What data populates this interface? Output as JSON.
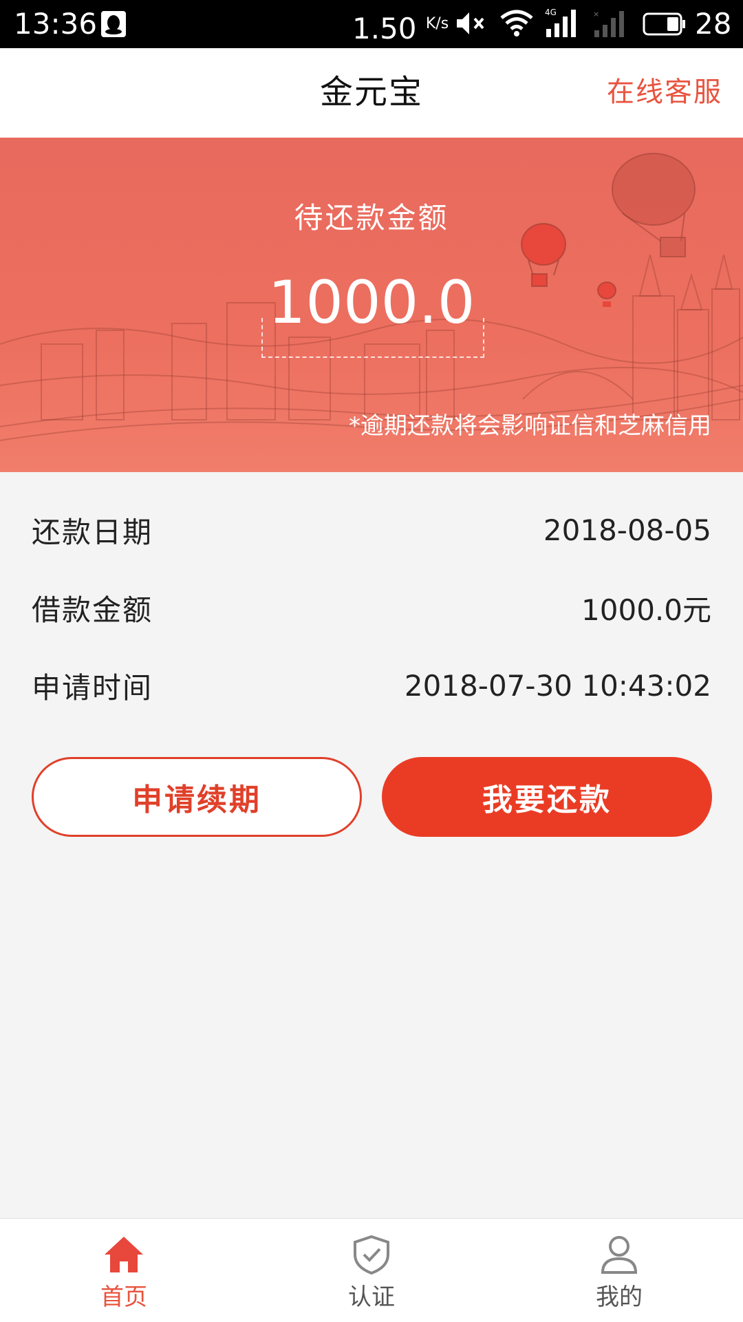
{
  "status_bar": {
    "time": "13:36",
    "speed": "1.50",
    "speed_unit": "K/s",
    "battery": "28",
    "icons": [
      "qq-icon",
      "mute-icon",
      "wifi-icon",
      "signal-4g-icon",
      "signal-empty-icon",
      "battery-icon"
    ]
  },
  "header": {
    "title": "金元宝",
    "service_link": "在线客服"
  },
  "banner": {
    "label": "待还款金额",
    "amount": "1000.0",
    "note": "*逾期还款将会影响证信和芝麻信用"
  },
  "details": [
    {
      "label": "还款日期",
      "value": "2018-08-05"
    },
    {
      "label": "借款金额",
      "value": "1000.0元"
    },
    {
      "label": "申请时间",
      "value": "2018-07-30 10:43:02"
    }
  ],
  "actions": {
    "renew": "申请续期",
    "repay": "我要还款"
  },
  "nav": {
    "items": [
      {
        "label": "首页",
        "icon": "home-icon",
        "active": true
      },
      {
        "label": "认证",
        "icon": "shield-check-icon",
        "active": false
      },
      {
        "label": "我的",
        "icon": "user-icon",
        "active": false
      }
    ]
  },
  "colors": {
    "accent": "#ea3c25",
    "banner": "#ec6f5f",
    "link": "#e8533f",
    "background": "#f4f4f4"
  }
}
